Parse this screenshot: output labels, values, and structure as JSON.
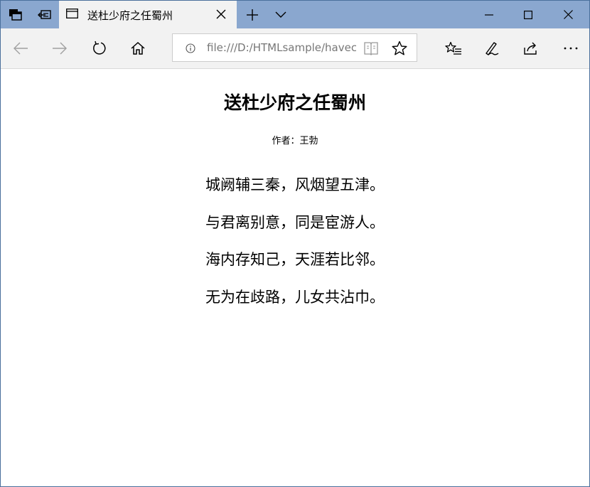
{
  "tab": {
    "title": "送杜少府之任蜀州"
  },
  "address_bar": {
    "url": "file:///D:/HTMLsample/havecss.html"
  },
  "page": {
    "title": "送杜少府之任蜀州",
    "author": "作者：王勃",
    "lines": [
      "城阙辅三秦，风烟望五津。",
      "与君离别意，同是宦游人。",
      "海内存知己，天涯若比邻。",
      "无为在歧路，儿女共沾巾。"
    ]
  },
  "colors": {
    "titlebar": "#8aa7cf",
    "tab_bg": "#f2f2f2",
    "navbar_bg": "#f2f2f2",
    "text": "#000000"
  },
  "icons": {
    "tab_list": "tab-list-icon",
    "set_aside": "set-aside-tabs-icon",
    "page": "page-icon",
    "tab_close": "close-icon",
    "new_tab": "plus-icon",
    "tab_preview": "chevron-down-icon",
    "minimize": "minimize-icon",
    "maximize": "maximize-icon",
    "close_window": "close-icon",
    "back": "arrow-left-icon",
    "forward": "arrow-right-icon",
    "refresh": "refresh-icon",
    "home": "home-icon",
    "info": "info-icon",
    "reading_view": "book-icon",
    "favorite": "star-icon",
    "favorites_hub": "favorites-list-icon",
    "notes": "pen-icon",
    "share": "share-icon",
    "more": "more-icon"
  }
}
